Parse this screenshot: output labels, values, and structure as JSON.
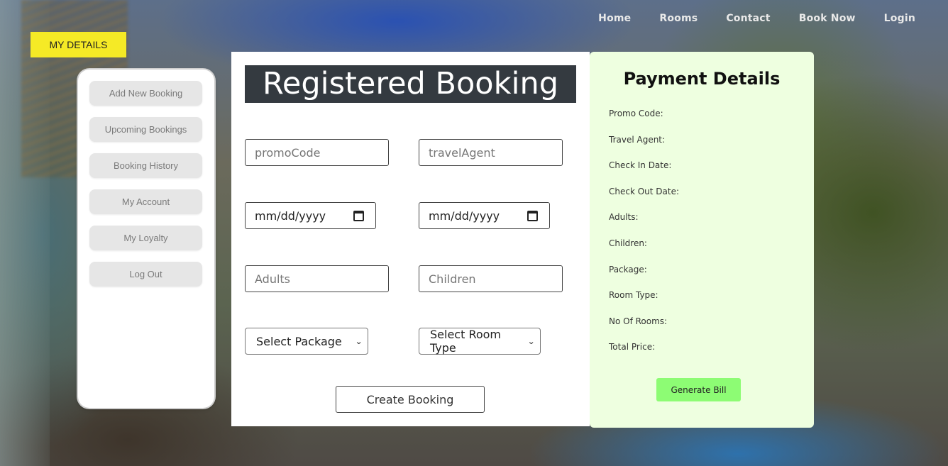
{
  "nav": {
    "items": [
      "Home",
      "Rooms",
      "Contact",
      "Book Now",
      "Login"
    ]
  },
  "my_details_label": "MY DETAILS",
  "sidebar": {
    "items": [
      {
        "label": "Add New Booking"
      },
      {
        "label": "Upcoming Bookings"
      },
      {
        "label": "Booking History"
      },
      {
        "label": "My Account"
      },
      {
        "label": "My Loyalty"
      },
      {
        "label": "Log Out"
      }
    ]
  },
  "booking": {
    "title": "Registered Booking",
    "promo_placeholder": "promoCode",
    "agent_placeholder": "travelAgent",
    "checkin_placeholder": "mm/dd/yyyy",
    "checkout_placeholder": "mm/dd/yyyy",
    "adults_placeholder": "Adults",
    "children_placeholder": "Children",
    "package_select": "Select Package",
    "room_select": "Select Room Type",
    "create_label": "Create Booking"
  },
  "payment": {
    "title": "Payment Details",
    "fields": [
      "Promo Code:",
      "Travel Agent:",
      "Check In Date:",
      "Check Out Date:",
      "Adults:",
      "Children:",
      "Package:",
      "Room Type:",
      "No Of Rooms:",
      "Total Price:"
    ],
    "button_label": "Generate Bill"
  },
  "colors": {
    "accent_yellow": "#f5ea26",
    "title_bar": "#343a40",
    "payment_bg": "#eeffe0",
    "generate_green": "#8dfc74"
  }
}
